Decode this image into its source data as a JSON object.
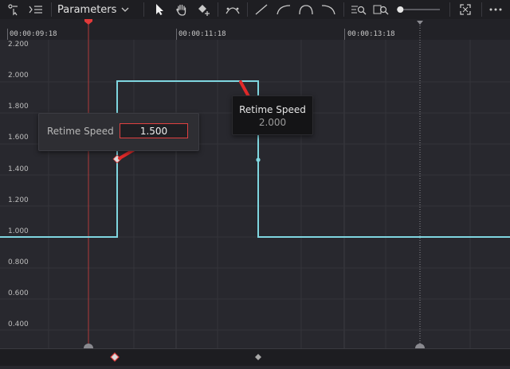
{
  "toolbar": {
    "dropdown_label": "Parameters",
    "icons": [
      "curve-select-icon",
      "list-icon",
      "chevron-down-icon",
      "pointer-icon",
      "hand-icon",
      "keyframe-add-icon",
      "bezier-curve-icon",
      "linear-icon",
      "ease-in-icon",
      "ease-in-out-icon",
      "ease-out-icon",
      "zoom-fit-icon",
      "zoom-curve-icon",
      "zoom-slider",
      "fullscreen-icon",
      "more-icon"
    ],
    "zoom_level": 0.08
  },
  "ruler": {
    "timecodes": [
      "00:00:09:18",
      "00:00:11:18",
      "00:00:13:18"
    ]
  },
  "graph": {
    "y_labels": [
      "2.200",
      "2.000",
      "1.800",
      "1.600",
      "1.400",
      "1.200",
      "1.000",
      "0.800",
      "0.600",
      "0.400"
    ],
    "curve_color": "#7fd6e0",
    "playhead_color": "#e23a3a"
  },
  "retime_edit": {
    "label": "Retime Speed",
    "value": "1.500"
  },
  "retime_tooltip": {
    "label": "Retime Speed",
    "value": "2.000"
  }
}
